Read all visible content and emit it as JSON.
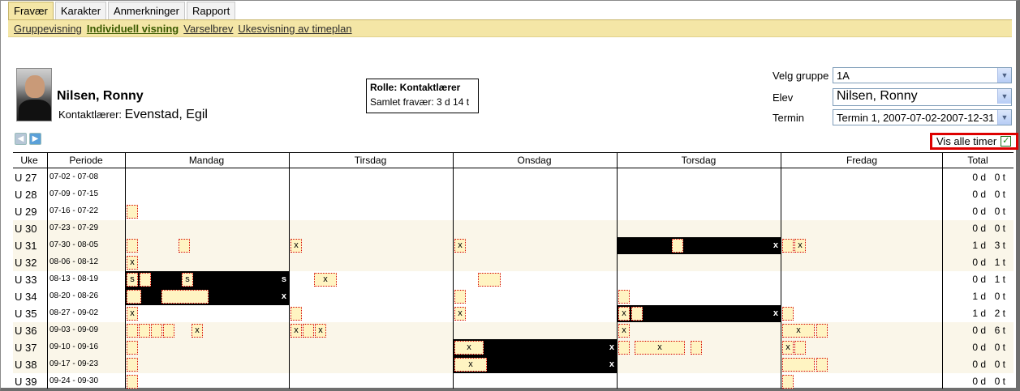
{
  "tabs": [
    "Fravær",
    "Karakter",
    "Anmerkninger",
    "Rapport"
  ],
  "subnav": [
    "Gruppevisning",
    "Individuell visning",
    "Varselbrev",
    "Ukesvisning av timeplan"
  ],
  "student": {
    "name": "Nilsen, Ronny",
    "teacher_label": "Kontaktlærer:",
    "teacher_name": "Evenstad, Egil"
  },
  "role": {
    "title": "Rolle: Kontaktlærer",
    "absence": "Samlet fravær: 3 d 14 t"
  },
  "filters": {
    "group_label": "Velg gruppe",
    "group_value": "1A",
    "student_label": "Elev",
    "student_value": "Nilsen, Ronny",
    "term_label": "Termin",
    "term_value": "Termin 1, 2007-07-02-2007-12-31"
  },
  "show_all": {
    "label": "Vis alle timer",
    "checked": true
  },
  "columns": [
    "Uke",
    "Periode",
    "Mandag",
    "Tirsdag",
    "Onsdag",
    "Torsdag",
    "Fredag",
    "Total"
  ],
  "rows": [
    {
      "week": "U 27",
      "period": "07-02 - 07-08",
      "days": "0 d",
      "hours": "0 t"
    },
    {
      "week": "U 28",
      "period": "07-09 - 07-15",
      "days": "0 d",
      "hours": "0 t"
    },
    {
      "week": "U 29",
      "period": "07-16 - 07-22",
      "days": "0 d",
      "hours": "0 t"
    },
    {
      "week": "U 30",
      "period": "07-23 - 07-29",
      "days": "0 d",
      "hours": "0 t"
    },
    {
      "week": "U 31",
      "period": "07-30 - 08-05",
      "days": "1 d",
      "hours": "3 t"
    },
    {
      "week": "U 32",
      "period": "08-06 - 08-12",
      "days": "0 d",
      "hours": "1 t"
    },
    {
      "week": "U 33",
      "period": "08-13 - 08-19",
      "days": "0 d",
      "hours": "1 t"
    },
    {
      "week": "U 34",
      "period": "08-20 - 08-26",
      "days": "1 d",
      "hours": "0 t"
    },
    {
      "week": "U 35",
      "period": "08-27 - 09-02",
      "days": "1 d",
      "hours": "2 t"
    },
    {
      "week": "U 36",
      "period": "09-03 - 09-09",
      "days": "0 d",
      "hours": "6 t"
    },
    {
      "week": "U 37",
      "period": "09-10 - 09-16",
      "days": "0 d",
      "hours": "0 t"
    },
    {
      "week": "U 38",
      "period": "09-17 - 09-23",
      "days": "0 d",
      "hours": "0 t"
    },
    {
      "week": "U 39",
      "period": "09-24 - 09-30",
      "days": "0 d",
      "hours": "0 t"
    }
  ],
  "marks": {
    "x": "x",
    "s": "s"
  }
}
